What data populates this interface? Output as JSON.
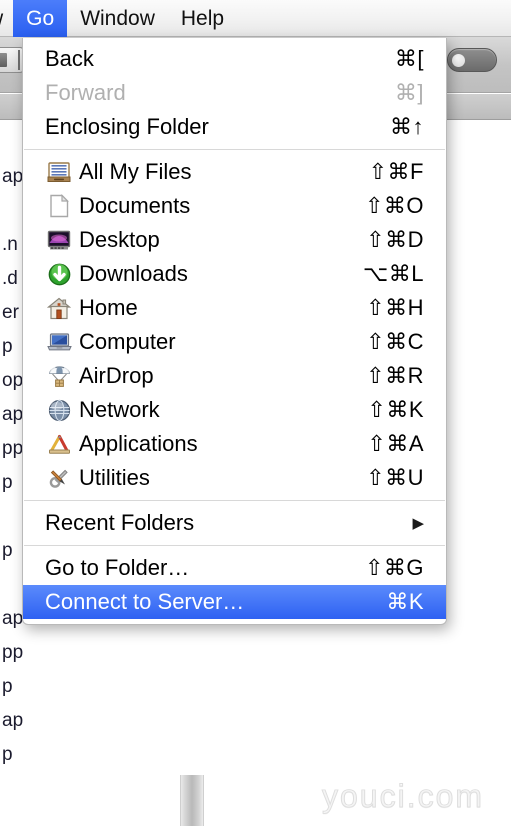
{
  "menubar": {
    "items": [
      {
        "label": "w",
        "state": "clipped"
      },
      {
        "label": "Go",
        "state": "active"
      },
      {
        "label": "Window",
        "state": "normal"
      },
      {
        "label": "Help",
        "state": "normal"
      }
    ]
  },
  "colors": {
    "highlight_blue": "#2e61f2",
    "highlight_blue_light": "#5b8bfc",
    "menu_bg": "#ffffff",
    "menu_border": "#b9b9b9",
    "separator": "#d8d8d8",
    "disabled_text": "#b0b0b0",
    "text": "#000000",
    "watermark": "#dedede"
  },
  "menu": {
    "title": "Go",
    "groups": [
      {
        "items": [
          {
            "label": "Back",
            "shortcut": "⌘[",
            "icon": null,
            "state": "normal",
            "submenu": false
          },
          {
            "label": "Forward",
            "shortcut": "⌘]",
            "icon": null,
            "state": "disabled",
            "submenu": false
          },
          {
            "label": "Enclosing Folder",
            "shortcut": "⌘↑",
            "icon": null,
            "state": "normal",
            "submenu": false
          }
        ]
      },
      {
        "items": [
          {
            "label": "All My Files",
            "shortcut": "⇧⌘F",
            "icon": "all-my-files-icon",
            "state": "normal",
            "submenu": false
          },
          {
            "label": "Documents",
            "shortcut": "⇧⌘O",
            "icon": "documents-icon",
            "state": "normal",
            "submenu": false
          },
          {
            "label": "Desktop",
            "shortcut": "⇧⌘D",
            "icon": "desktop-icon",
            "state": "normal",
            "submenu": false
          },
          {
            "label": "Downloads",
            "shortcut": "⌥⌘L",
            "icon": "downloads-icon",
            "state": "normal",
            "submenu": false
          },
          {
            "label": "Home",
            "shortcut": "⇧⌘H",
            "icon": "home-icon",
            "state": "normal",
            "submenu": false
          },
          {
            "label": "Computer",
            "shortcut": "⇧⌘C",
            "icon": "computer-icon",
            "state": "normal",
            "submenu": false
          },
          {
            "label": "AirDrop",
            "shortcut": "⇧⌘R",
            "icon": "airdrop-icon",
            "state": "normal",
            "submenu": false
          },
          {
            "label": "Network",
            "shortcut": "⇧⌘K",
            "icon": "network-icon",
            "state": "normal",
            "submenu": false
          },
          {
            "label": "Applications",
            "shortcut": "⇧⌘A",
            "icon": "applications-icon",
            "state": "normal",
            "submenu": false
          },
          {
            "label": "Utilities",
            "shortcut": "⇧⌘U",
            "icon": "utilities-icon",
            "state": "normal",
            "submenu": false
          }
        ]
      },
      {
        "items": [
          {
            "label": "Recent Folders",
            "shortcut": "",
            "icon": null,
            "state": "normal",
            "submenu": true
          }
        ]
      },
      {
        "items": [
          {
            "label": "Go to Folder…",
            "shortcut": "⇧⌘G",
            "icon": null,
            "state": "normal",
            "submenu": false
          },
          {
            "label": "Connect to Server…",
            "shortcut": "⌘K",
            "icon": null,
            "state": "highlight",
            "submenu": false
          }
        ]
      }
    ],
    "submenu_arrow_glyph": "▶"
  },
  "background_window": {
    "list_fragments": [
      "app",
      "",
      ".n",
      ".d",
      "er",
      "p",
      "op",
      "ap",
      "pp",
      "p",
      "",
      "p",
      "",
      "ap",
      "pp",
      "p",
      "ap",
      "p"
    ]
  },
  "watermark": {
    "text": "youci.com"
  }
}
